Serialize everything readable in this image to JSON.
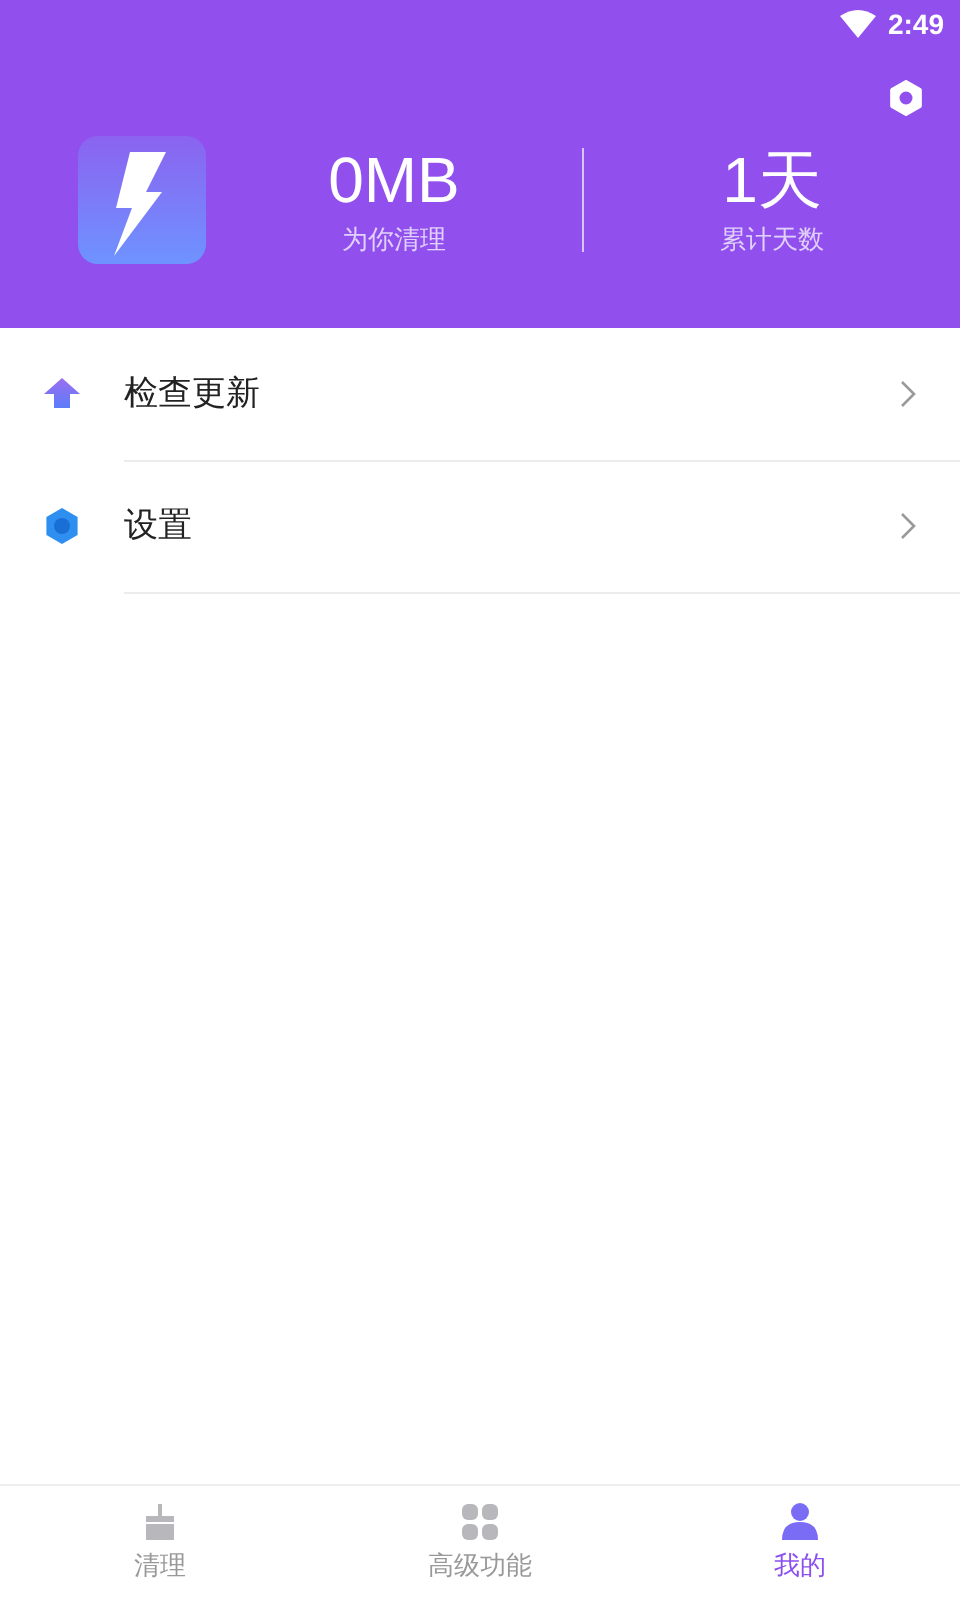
{
  "status_bar": {
    "time": "2:49"
  },
  "header": {
    "stats": [
      {
        "value": "0MB",
        "label": "为你清理"
      },
      {
        "value": "1天",
        "label": "累计天数"
      }
    ]
  },
  "menu": [
    {
      "kind": "update",
      "label": "检查更新"
    },
    {
      "kind": "settings",
      "label": "设置"
    }
  ],
  "tabs": [
    {
      "kind": "clean",
      "label": "清理",
      "selected": false
    },
    {
      "kind": "advanced",
      "label": "高级功能",
      "selected": false
    },
    {
      "kind": "me",
      "label": "我的",
      "selected": true
    }
  ]
}
